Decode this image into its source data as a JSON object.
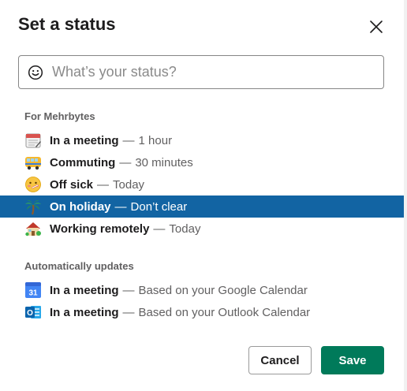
{
  "dialog": {
    "title": "Set a status",
    "close_icon": "close-icon"
  },
  "search": {
    "placeholder": "What’s your status?",
    "value": "",
    "icon": "smiley-icon"
  },
  "suggested": {
    "heading": "For Mehrbytes",
    "items": [
      {
        "icon": "calendar-icon",
        "name": "In a meeting",
        "dash": "—",
        "duration": "1 hour",
        "selected": false
      },
      {
        "icon": "bus-icon",
        "name": "Commuting",
        "dash": "—",
        "duration": "30 minutes",
        "selected": false
      },
      {
        "icon": "sick-face-icon",
        "name": "Off sick",
        "dash": "—",
        "duration": "Today",
        "selected": false
      },
      {
        "icon": "palm-tree-icon",
        "name": "On holiday",
        "dash": "—",
        "duration": "Don’t clear",
        "selected": true
      },
      {
        "icon": "house-icon",
        "name": "Working remotely",
        "dash": "—",
        "duration": "Today",
        "selected": false
      }
    ]
  },
  "automatic": {
    "heading": "Automatically updates",
    "items": [
      {
        "icon": "google-calendar-icon",
        "name": "In a meeting",
        "dash": "—",
        "source": "Based on your Google Calendar",
        "icon_text": "31"
      },
      {
        "icon": "outlook-calendar-icon",
        "name": "In a meeting",
        "dash": "—",
        "source": "Based on your Outlook Calendar",
        "icon_text": "O"
      }
    ]
  },
  "footer": {
    "cancel_label": "Cancel",
    "save_label": "Save"
  },
  "colors": {
    "selected_row": "#1264a3",
    "save_button": "#007a5a"
  }
}
